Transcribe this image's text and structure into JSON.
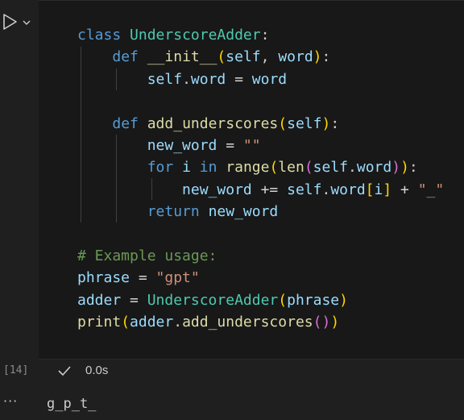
{
  "cell": {
    "execution_count": "[14]",
    "status_icon": "check-icon",
    "duration": "0.0s",
    "run_icon": "play-icon",
    "run_menu_icon": "chevron-down-icon",
    "code_lines": [
      [
        {
          "t": "class ",
          "c": "kw"
        },
        {
          "t": "UnderscoreAdder",
          "c": "cls"
        },
        {
          "t": ":",
          "c": "plain"
        }
      ],
      [
        {
          "t": "    "
        },
        {
          "t": "def ",
          "c": "kw"
        },
        {
          "t": "__init__",
          "c": "fn"
        },
        {
          "t": "(",
          "c": "p1"
        },
        {
          "t": "self",
          "c": "var"
        },
        {
          "t": ", ",
          "c": "plain"
        },
        {
          "t": "word",
          "c": "var"
        },
        {
          "t": ")",
          "c": "p1"
        },
        {
          "t": ":",
          "c": "plain"
        }
      ],
      [
        {
          "t": "        "
        },
        {
          "t": "self",
          "c": "var"
        },
        {
          "t": ".",
          "c": "plain"
        },
        {
          "t": "word",
          "c": "var"
        },
        {
          "t": " = ",
          "c": "op"
        },
        {
          "t": "word",
          "c": "var"
        }
      ],
      [
        {
          "t": ""
        }
      ],
      [
        {
          "t": "    "
        },
        {
          "t": "def ",
          "c": "kw"
        },
        {
          "t": "add_underscores",
          "c": "fn"
        },
        {
          "t": "(",
          "c": "p1"
        },
        {
          "t": "self",
          "c": "var"
        },
        {
          "t": ")",
          "c": "p1"
        },
        {
          "t": ":",
          "c": "plain"
        }
      ],
      [
        {
          "t": "        "
        },
        {
          "t": "new_word",
          "c": "var"
        },
        {
          "t": " = ",
          "c": "op"
        },
        {
          "t": "\"\"",
          "c": "str"
        }
      ],
      [
        {
          "t": "        "
        },
        {
          "t": "for ",
          "c": "kw"
        },
        {
          "t": "i ",
          "c": "var"
        },
        {
          "t": "in ",
          "c": "kw"
        },
        {
          "t": "range",
          "c": "fn"
        },
        {
          "t": "(",
          "c": "p1"
        },
        {
          "t": "len",
          "c": "fn"
        },
        {
          "t": "(",
          "c": "p2"
        },
        {
          "t": "self",
          "c": "var"
        },
        {
          "t": ".",
          "c": "plain"
        },
        {
          "t": "word",
          "c": "var"
        },
        {
          "t": ")",
          "c": "p2"
        },
        {
          "t": ")",
          "c": "p1"
        },
        {
          "t": ":",
          "c": "plain"
        }
      ],
      [
        {
          "t": "            "
        },
        {
          "t": "new_word",
          "c": "var"
        },
        {
          "t": " += ",
          "c": "op"
        },
        {
          "t": "self",
          "c": "var"
        },
        {
          "t": ".",
          "c": "plain"
        },
        {
          "t": "word",
          "c": "var"
        },
        {
          "t": "[",
          "c": "p1"
        },
        {
          "t": "i",
          "c": "var"
        },
        {
          "t": "]",
          "c": "p1"
        },
        {
          "t": " + ",
          "c": "op"
        },
        {
          "t": "\"_\"",
          "c": "str"
        }
      ],
      [
        {
          "t": "        "
        },
        {
          "t": "return ",
          "c": "kw"
        },
        {
          "t": "new_word",
          "c": "var"
        }
      ],
      [
        {
          "t": ""
        }
      ],
      [
        {
          "t": "# Example usage:",
          "c": "cmt"
        }
      ],
      [
        {
          "t": "phrase",
          "c": "var"
        },
        {
          "t": " = ",
          "c": "op"
        },
        {
          "t": "\"gpt\"",
          "c": "str"
        }
      ],
      [
        {
          "t": "adder",
          "c": "var"
        },
        {
          "t": " = ",
          "c": "op"
        },
        {
          "t": "UnderscoreAdder",
          "c": "cls"
        },
        {
          "t": "(",
          "c": "p1"
        },
        {
          "t": "phrase",
          "c": "var"
        },
        {
          "t": ")",
          "c": "p1"
        }
      ],
      [
        {
          "t": "print",
          "c": "fn"
        },
        {
          "t": "(",
          "c": "p1"
        },
        {
          "t": "adder",
          "c": "var"
        },
        {
          "t": ".",
          "c": "plain"
        },
        {
          "t": "add_underscores",
          "c": "fn"
        },
        {
          "t": "(",
          "c": "p2"
        },
        {
          "t": ")",
          "c": "p2"
        },
        {
          "t": ")",
          "c": "p1"
        }
      ]
    ]
  },
  "output": {
    "menu_icon": "ellipsis-icon",
    "menu_label": "···",
    "text": "g_p_t_"
  }
}
